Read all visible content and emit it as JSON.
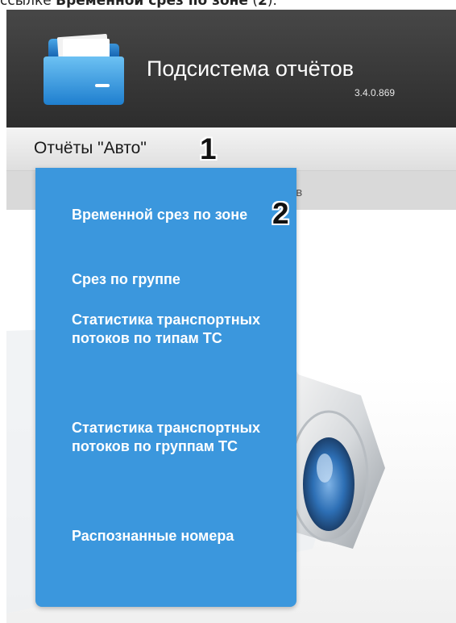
{
  "caption": {
    "prefix": "ссылке ",
    "bold_link": "Временной срез по зоне",
    "mid": " (",
    "bold_num": "2",
    "suffix": ")."
  },
  "app": {
    "title": "Подсистема отчётов",
    "version": "3.4.0.869"
  },
  "menu": {
    "trigger_label": "Отчёты \"Авто\""
  },
  "tabs": {
    "partial_label": "чётов"
  },
  "dropdown": {
    "items": [
      {
        "label": "Временной срез по зоне"
      },
      {
        "label": "Срез по группе"
      },
      {
        "label": "Статистика транспортных потоков по типам ТС"
      },
      {
        "label": "Статистика транспортных потоков по группам ТС"
      },
      {
        "label": "Распознанные номера"
      }
    ]
  },
  "callouts": {
    "one": "1",
    "two": "2"
  },
  "colors": {
    "header": "#3a3a3a",
    "menu_bg": "#e6e6e6",
    "dropdown": "#3b97dd",
    "logo": "#4aa7e8"
  },
  "icons": {
    "logo": "folder-icon"
  }
}
